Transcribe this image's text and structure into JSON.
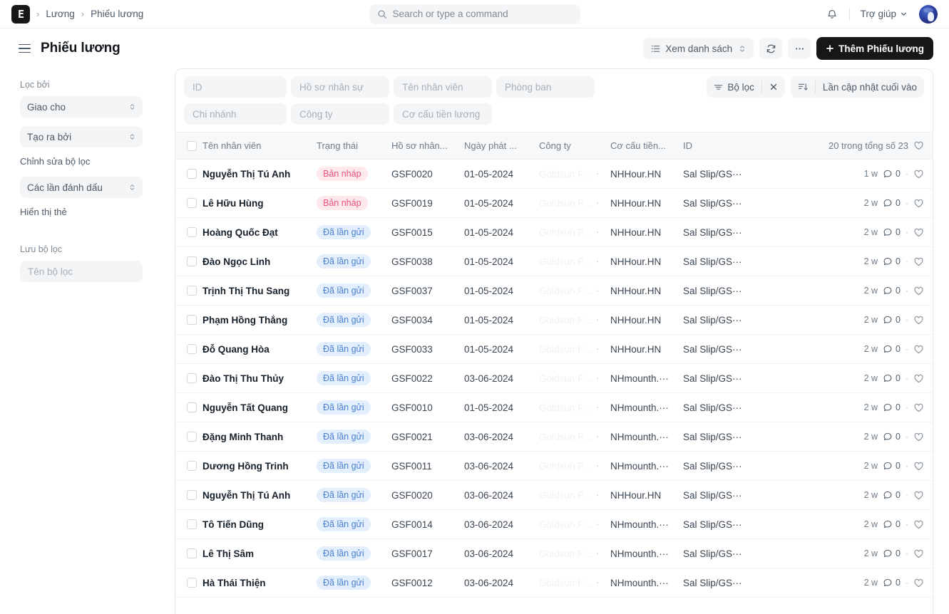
{
  "navbar": {
    "logo_text": "E",
    "breadcrumbs": [
      "Lương",
      "Phiếu lương"
    ],
    "search_placeholder": "Search or type a command",
    "search_value": "",
    "notification_icon": "bell-icon",
    "help_label": "Trợ giúp"
  },
  "page": {
    "title": "Phiếu lương",
    "view_list_label": "Xem danh sách",
    "refresh_icon": "refresh-icon",
    "more_label": "···",
    "add_label": "Thêm Phiếu lương"
  },
  "sidebar": {
    "filter_by_label": "Lọc bởi",
    "assigned_to": "Giao cho",
    "created_by": "Tạo ra bởi",
    "edit_filters_label": "Chỉnh sửa bộ lọc",
    "tags_select": "Các lần đánh dấu",
    "show_tags_label": "Hiển thị thẻ",
    "save_filter_label": "Lưu bộ lọc",
    "filter_name_placeholder": "Tên bộ lọc",
    "filter_name_value": ""
  },
  "filters": {
    "row1": [
      {
        "name": "id-filter",
        "placeholder": "ID",
        "value": ""
      },
      {
        "name": "employee-record-filter",
        "placeholder": "Hồ sơ nhân sự",
        "value": ""
      },
      {
        "name": "employee-name-filter",
        "placeholder": "Tên nhân viên",
        "value": ""
      },
      {
        "name": "department-filter",
        "placeholder": "Phòng ban",
        "value": ""
      }
    ],
    "row2": [
      {
        "name": "branch-filter",
        "placeholder": "Chi nhánh",
        "value": ""
      },
      {
        "name": "company-filter",
        "placeholder": "Công ty",
        "value": ""
      },
      {
        "name": "salary-structure-filter",
        "placeholder": "Cơ cấu tiền lương",
        "value": ""
      }
    ],
    "filter_button": "Bộ lọc",
    "clear_icon": "close-icon",
    "sort_label": "Lần cập nhật cuối vào"
  },
  "table": {
    "headers": {
      "name": "Tên nhân viên",
      "status": "Trạng thái",
      "employee_record": "Hồ sơ nhân...",
      "issue_date": "Ngày phát ...",
      "company": "Công ty",
      "salary_structure": "Cơ cấu tiền...",
      "id": "ID"
    },
    "count_label": "20 trong tổng số 23",
    "heart_icon": "heart-icon",
    "company_ghost": "Goldsun Fo··",
    "rows": [
      {
        "name": "Nguyễn Thị Tú Anh",
        "status": "Bản nháp",
        "status_type": "draft",
        "record": "GSF0020",
        "date": "01-05-2024",
        "structure": "NHHour.HN",
        "id": "Sal Slip/GS···",
        "age": "1 w",
        "comments": "0"
      },
      {
        "name": "Lê Hữu Hùng",
        "status": "Bản nháp",
        "status_type": "draft",
        "record": "GSF0019",
        "date": "01-05-2024",
        "structure": "NHHour.HN",
        "id": "Sal Slip/GS···",
        "age": "2 w",
        "comments": "0"
      },
      {
        "name": "Hoàng Quốc Đạt",
        "status": "Đã lần gửi",
        "status_type": "sent",
        "record": "GSF0015",
        "date": "01-05-2024",
        "structure": "NHHour.HN",
        "id": "Sal Slip/GS···",
        "age": "2 w",
        "comments": "0"
      },
      {
        "name": "Đào Ngọc Linh",
        "status": "Đã lần gửi",
        "status_type": "sent",
        "record": "GSF0038",
        "date": "01-05-2024",
        "structure": "NHHour.HN",
        "id": "Sal Slip/GS···",
        "age": "2 w",
        "comments": "0"
      },
      {
        "name": "Trịnh Thị Thu Sang",
        "status": "Đã lần gửi",
        "status_type": "sent",
        "record": "GSF0037",
        "date": "01-05-2024",
        "structure": "NHHour.HN",
        "id": "Sal Slip/GS···",
        "age": "2 w",
        "comments": "0"
      },
      {
        "name": "Phạm Hồng Thắng",
        "status": "Đã lần gửi",
        "status_type": "sent",
        "record": "GSF0034",
        "date": "01-05-2024",
        "structure": "NHHour.HN",
        "id": "Sal Slip/GS···",
        "age": "2 w",
        "comments": "0"
      },
      {
        "name": "Đỗ Quang Hòa",
        "status": "Đã lần gửi",
        "status_type": "sent",
        "record": "GSF0033",
        "date": "01-05-2024",
        "structure": "NHHour.HN",
        "id": "Sal Slip/GS···",
        "age": "2 w",
        "comments": "0"
      },
      {
        "name": "Đào Thị Thu Thủy",
        "status": "Đã lần gửi",
        "status_type": "sent",
        "record": "GSF0022",
        "date": "03-06-2024",
        "structure": "NHmounth.···",
        "id": "Sal Slip/GS···",
        "age": "2 w",
        "comments": "0"
      },
      {
        "name": "Nguyễn Tất Quang",
        "status": "Đã lần gửi",
        "status_type": "sent",
        "record": "GSF0010",
        "date": "01-05-2024",
        "structure": "NHmounth.···",
        "id": "Sal Slip/GS···",
        "age": "2 w",
        "comments": "0"
      },
      {
        "name": "Đặng Minh Thanh",
        "status": "Đã lần gửi",
        "status_type": "sent",
        "record": "GSF0021",
        "date": "03-06-2024",
        "structure": "NHmounth.···",
        "id": "Sal Slip/GS···",
        "age": "2 w",
        "comments": "0"
      },
      {
        "name": "Dương Hồng Trinh",
        "status": "Đã lần gửi",
        "status_type": "sent",
        "record": "GSF0011",
        "date": "03-06-2024",
        "structure": "NHmounth.···",
        "id": "Sal Slip/GS···",
        "age": "2 w",
        "comments": "0"
      },
      {
        "name": "Nguyễn Thị Tú Anh",
        "status": "Đã lần gửi",
        "status_type": "sent",
        "record": "GSF0020",
        "date": "03-06-2024",
        "structure": "NHHour.HN",
        "id": "Sal Slip/GS···",
        "age": "2 w",
        "comments": "0"
      },
      {
        "name": "Tô Tiến Dũng",
        "status": "Đã lần gửi",
        "status_type": "sent",
        "record": "GSF0014",
        "date": "03-06-2024",
        "structure": "NHmounth.···",
        "id": "Sal Slip/GS···",
        "age": "2 w",
        "comments": "0"
      },
      {
        "name": "Lê Thị Sâm",
        "status": "Đã lần gửi",
        "status_type": "sent",
        "record": "GSF0017",
        "date": "03-06-2024",
        "structure": "NHmounth.···",
        "id": "Sal Slip/GS···",
        "age": "2 w",
        "comments": "0"
      },
      {
        "name": "Hà Thái Thiện",
        "status": "Đã lần gửi",
        "status_type": "sent",
        "record": "GSF0012",
        "date": "03-06-2024",
        "structure": "NHmounth.···",
        "id": "Sal Slip/GS···",
        "age": "2 w",
        "comments": "0"
      }
    ]
  },
  "colors": {
    "accent_dark": "#171717",
    "draft_bg": "#fde8ec",
    "draft_fg": "#e8537a",
    "sent_bg": "#e3effc",
    "sent_fg": "#4a7fd4",
    "surface": "#f4f5f6",
    "border": "#e7eaec"
  }
}
